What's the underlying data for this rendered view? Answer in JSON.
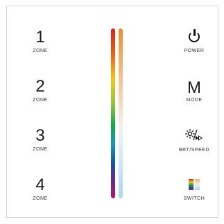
{
  "zones": [
    {
      "number": "1",
      "label": "ZONE"
    },
    {
      "number": "2",
      "label": "ZONE"
    },
    {
      "number": "3",
      "label": "ZONE"
    },
    {
      "number": "4",
      "label": "ZONE"
    }
  ],
  "controls": {
    "power_label": "POWER",
    "mode_symbol": "M",
    "mode_label": "MODE",
    "brightness_speed_label": "BRT/SPEED",
    "switch_label": "SWITCH"
  },
  "sliders": {
    "color": {
      "icon": "rgb-color-touch-bar"
    },
    "white": {
      "icon": "color-temperature-touch-bar"
    }
  },
  "colors": {
    "text": "#1a1a1a",
    "border": "#d2d2d2"
  }
}
